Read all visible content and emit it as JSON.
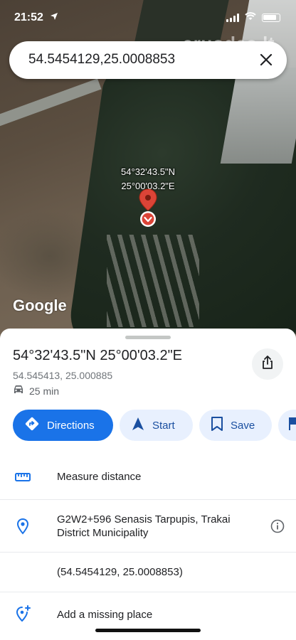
{
  "status_bar": {
    "time": "21:52"
  },
  "watermark": "aruodas.lt",
  "search": {
    "value": "54.5454129,25.0008853"
  },
  "map": {
    "pin_label_line1": "54°32'43.5\"N",
    "pin_label_line2": "25°00'03.2\"E",
    "logo_text": "Google"
  },
  "place": {
    "title": "54°32'43.5\"N 25°00'03.2\"E",
    "decimal_coords": "54.545413, 25.000885",
    "travel_time": "25 min"
  },
  "actions": {
    "directions": "Directions",
    "start": "Start",
    "save": "Save"
  },
  "rows": {
    "measure": "Measure distance",
    "address": "G2W2+596 Senasis Tarpupis, Trakai District Municipality",
    "coords": "(54.5454129, 25.0008853)",
    "add_place": "Add a missing place"
  },
  "colors": {
    "accent": "#1a73e8",
    "chip_bg": "#e8f0fe",
    "pin": "#db4437"
  },
  "icons": [
    "location-arrow-icon",
    "signal-icon",
    "wifi-icon",
    "battery-icon",
    "close-icon",
    "map-pin-icon",
    "car-icon",
    "share-icon",
    "directions-icon",
    "navigation-arrow-icon",
    "bookmark-icon",
    "flag-icon",
    "ruler-icon",
    "location-icon",
    "info-icon",
    "add-place-icon"
  ]
}
